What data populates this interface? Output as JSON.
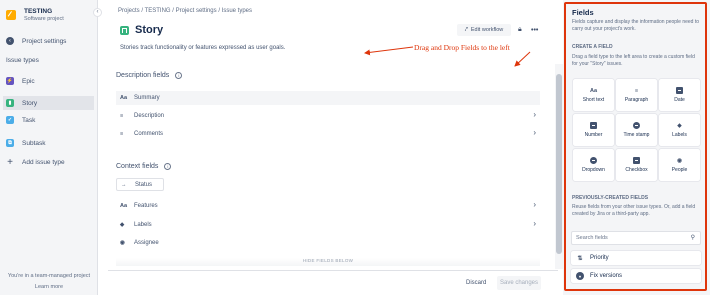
{
  "sidebar": {
    "project_name": "TESTING",
    "project_type": "Software project",
    "project_settings": "Project settings",
    "issue_types_heading": "Issue types",
    "items": [
      {
        "label": "Epic",
        "icon": "epic-icon",
        "color": "#6554c0",
        "glyph": "⚡"
      },
      {
        "label": "Story",
        "icon": "story-icon",
        "color": "#36b37e",
        "glyph": ""
      },
      {
        "label": "Task",
        "icon": "task-icon",
        "color": "#4bade8",
        "glyph": "✓"
      },
      {
        "label": "Subtask",
        "icon": "subtask-icon",
        "color": "#4bade8",
        "glyph": "⧉"
      }
    ],
    "add_issue_type": "Add issue type",
    "footer_line1": "You're in a team-managed project",
    "footer_link": "Learn more"
  },
  "breadcrumb": [
    "Projects",
    "TESTING",
    "Project settings",
    "Issue types"
  ],
  "header": {
    "title": "Story",
    "edit_workflow": "Edit workflow",
    "description": "Stories track functionality or features expressed as user goals."
  },
  "description_fields": {
    "heading": "Description fields",
    "rows": [
      {
        "label": "Summary",
        "glyph": "Aa"
      },
      {
        "label": "Description",
        "glyph": "≡"
      },
      {
        "label": "Comments",
        "glyph": "≡"
      }
    ]
  },
  "context_fields": {
    "heading": "Context fields",
    "status_label": "Status",
    "rows": [
      {
        "label": "Features",
        "glyph": "Aa"
      },
      {
        "label": "Labels",
        "glyph": "◆"
      },
      {
        "label": "Assignee",
        "glyph": "◉"
      }
    ],
    "hide_fields": "HIDE FIELDS BELOW"
  },
  "annotation": {
    "text": "Drag and Drop Fields to the left",
    "color": "#de350b"
  },
  "footer": {
    "discard": "Discard",
    "save": "Save changes"
  },
  "fields_panel": {
    "title": "Fields",
    "description": "Fields capture and display the information people need to carry out your project's work.",
    "create_heading": "CREATE A FIELD",
    "create_description": "Drag a field type to the left area to create a custom field for your \"Story\" issues.",
    "field_types": [
      {
        "label": "Short text",
        "icon": "short-text-icon"
      },
      {
        "label": "Paragraph",
        "icon": "paragraph-icon"
      },
      {
        "label": "Date",
        "icon": "date-icon"
      },
      {
        "label": "Number",
        "icon": "number-icon"
      },
      {
        "label": "Time stamp",
        "icon": "time-stamp-icon"
      },
      {
        "label": "Labels",
        "icon": "labels-icon"
      },
      {
        "label": "Dropdown",
        "icon": "dropdown-icon"
      },
      {
        "label": "Checkbox",
        "icon": "checkbox-icon"
      },
      {
        "label": "People",
        "icon": "people-icon"
      }
    ],
    "previous_heading": "PREVIOUSLY-CREATED FIELDS",
    "previous_description": "Reuse fields from your other issue types. Or, add a field created by Jira or a third-party app.",
    "search_placeholder": "Search fields",
    "previous_fields": [
      {
        "label": "Priority",
        "icon": "priority-icon"
      },
      {
        "label": "Fix versions",
        "icon": "fix-versions-icon"
      }
    ]
  }
}
